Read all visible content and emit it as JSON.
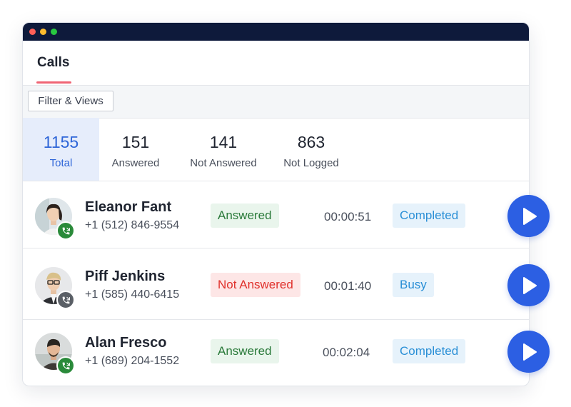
{
  "window": {
    "title_bar_dots": [
      "close",
      "minimize",
      "maximize"
    ]
  },
  "tabs": [
    {
      "label": "Calls",
      "active": true
    }
  ],
  "toolbar": {
    "filter_label": "Filter & Views"
  },
  "stats": [
    {
      "value": "1155",
      "label": "Total",
      "active": true
    },
    {
      "value": "151",
      "label": "Answered"
    },
    {
      "value": "141",
      "label": "Not Answered"
    },
    {
      "value": "863",
      "label": "Not Logged"
    }
  ],
  "calls": [
    {
      "name": "Eleanor Fant",
      "phone": "+1 (512) 846-9554",
      "answer_status": "Answered",
      "duration": "00:00:51",
      "call_status": "Completed",
      "badge": "phone-incoming-icon"
    },
    {
      "name": "Piff Jenkins",
      "phone": "+1 (585) 440-6415",
      "answer_status": "Not Answered",
      "duration": "00:01:40",
      "call_status": "Busy",
      "badge": "phone-missed-icon"
    },
    {
      "name": "Alan Fresco",
      "phone": "+1 (689) 204-1552",
      "answer_status": "Answered",
      "duration": "00:02:04",
      "call_status": "Completed",
      "badge": "phone-incoming-icon"
    }
  ],
  "colors": {
    "title_bar": "#0e1a3b",
    "accent_blue": "#2f66d8",
    "tab_underline": "#f06474",
    "play_button": "#2c5fe3",
    "answered_green": "#2a7a3a",
    "not_answered_red": "#e0302b",
    "status_blue": "#2a8fd6"
  }
}
